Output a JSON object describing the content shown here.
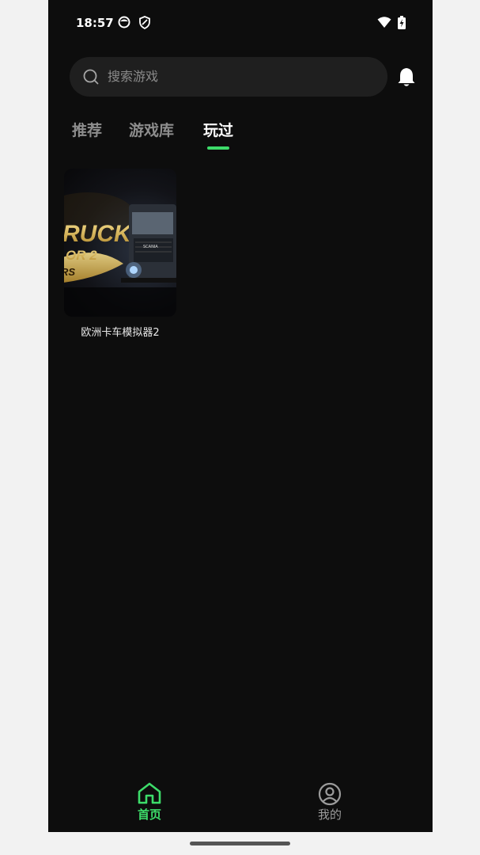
{
  "status_bar": {
    "time": "18:57"
  },
  "search": {
    "placeholder": "搜索游戏"
  },
  "tabs": [
    {
      "label": "推荐"
    },
    {
      "label": "游戏库"
    },
    {
      "label": "玩过"
    }
  ],
  "active_tab_index": 2,
  "played_games": [
    {
      "name": "欧洲卡车模拟器2",
      "cover_text": {
        "title_fragment": "RUCK",
        "subtitle_fragment": "OR 2",
        "badge_fragment": "RS",
        "truck_brand": "SCANIA"
      }
    }
  ],
  "bottom_nav": {
    "home_label": "首页",
    "mine_label": "我的"
  },
  "colors": {
    "accent": "#3ddc6a",
    "background": "#0d0d0d",
    "search_bg": "#1f1f1f",
    "inactive": "#8d8d8d"
  }
}
